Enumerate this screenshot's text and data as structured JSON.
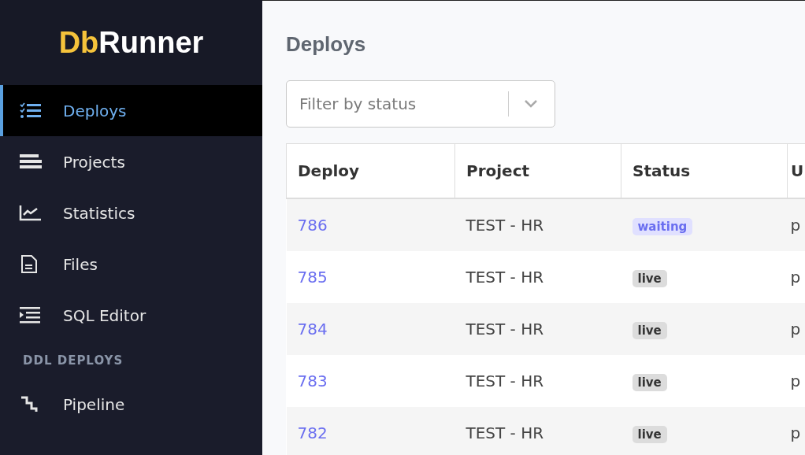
{
  "sidebar": {
    "logo": {
      "first": "Db",
      "second": "Runner"
    },
    "items": [
      {
        "label": "Deploys",
        "selected": true
      },
      {
        "label": "Projects",
        "selected": false
      },
      {
        "label": "Statistics",
        "selected": false
      },
      {
        "label": "Files",
        "selected": false
      },
      {
        "label": "SQL Editor",
        "selected": false
      }
    ],
    "section": "DDL DEPLOYS",
    "section_items": [
      {
        "label": "Pipeline",
        "selected": false
      }
    ]
  },
  "page": {
    "title": "Deploys",
    "filter": {
      "placeholder": "Filter by status"
    },
    "table": {
      "columns": [
        "Deploy",
        "Project",
        "Status",
        "U"
      ],
      "rows": [
        {
          "deploy": "786",
          "project": "TEST - HR",
          "status": "waiting",
          "kind": "waiting",
          "column_4": "p"
        },
        {
          "deploy": "785",
          "project": "TEST - HR",
          "status": "live",
          "kind": "live",
          "column_4": "p"
        },
        {
          "deploy": "784",
          "project": "TEST - HR",
          "status": "live",
          "kind": "live",
          "column_4": "p"
        },
        {
          "deploy": "783",
          "project": "TEST - HR",
          "status": "live",
          "kind": "live",
          "column_4": "p"
        },
        {
          "deploy": "782",
          "project": "TEST - HR",
          "status": "live",
          "kind": "live",
          "column_4": "p"
        }
      ]
    }
  }
}
